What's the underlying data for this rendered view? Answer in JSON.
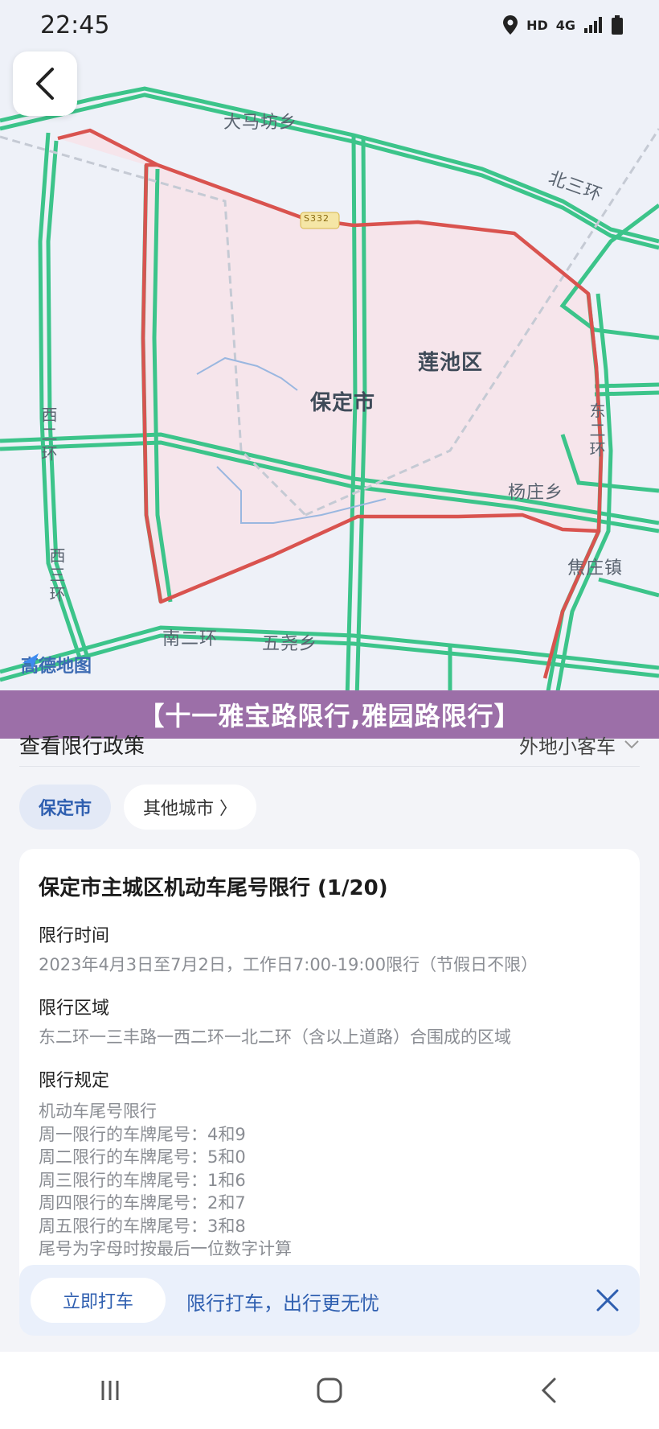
{
  "status_bar": {
    "time": "22:45",
    "hd": "HD",
    "network": "4G"
  },
  "map": {
    "labels": {
      "damafang": "大马坊乡",
      "north_ring": "北三环",
      "lianchi": "莲池区",
      "baoding": "保定市",
      "yangzhuang": "杨庄乡",
      "jiaozhuang": "焦庄镇",
      "east_ring": "东二环",
      "west_ring_2": "西二环",
      "west_ring_3": "西三环",
      "south_ring": "南二环",
      "wuyao": "五尧乡",
      "road_badge": "S332"
    },
    "logo": "高德地图",
    "colors": {
      "restricted_area": "#f6e4ea",
      "boundary": "#d9534f",
      "road": "#3cc48a"
    }
  },
  "banner": "【十一雅宝路限行,雅园路限行】",
  "policy": {
    "title": "查看限行政策",
    "vehicle_type": "外地小客车"
  },
  "city_chips": {
    "current": "保定市",
    "other": "其他城市 〉"
  },
  "card": {
    "title": "保定市主城区机动车尾号限行 (1/20)",
    "time_label": "限行时间",
    "time_value": "2023年4月3日至7月2日，工作日7:00-19:00限行（节假日不限）",
    "area_label": "限行区域",
    "area_value": "东二环一三丰路一西二环一北二环（含以上道路）合围成的区域",
    "rule_label": "限行规定",
    "rules": [
      "机动车尾号限行",
      "周一限行的车牌尾号：4和9",
      "周二限行的车牌尾号：5和0",
      "周三限行的车牌尾号：1和6",
      "周四限行的车牌尾号：2和7",
      "周五限行的车牌尾号：3和8",
      "尾号为字母时按最后一位数字计算"
    ]
  },
  "bottom_bar": {
    "button": "立即打车",
    "text": "限行打车，出行更无忧"
  }
}
